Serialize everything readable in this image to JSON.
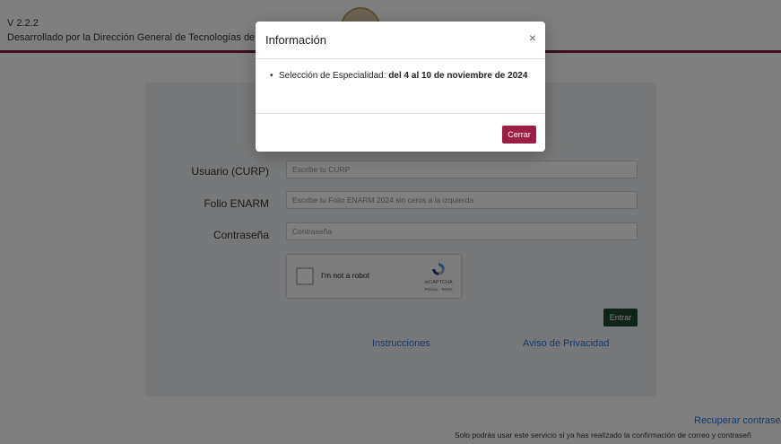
{
  "header": {
    "version": "V 2.2.2",
    "developer": "Desarrollado por la Dirección General de Tecnologías de la"
  },
  "form": {
    "curp_label": "Usuario (CURP)",
    "curp_placeholder": "Escribe tu CURP",
    "folio_label": "Folio ENARM",
    "folio_placeholder": "Escribe tu Folio ENARM 2024 sin ceros a la izquierda",
    "password_label": "Contraseña",
    "password_placeholder": "Contraseña",
    "recaptcha": {
      "label": "I'm not a robot",
      "brand": "reCAPTCHA",
      "terms": "Privacy - Terms"
    },
    "submit_label": "Entrar"
  },
  "links": {
    "instrucciones": "Instrucciones",
    "privacidad": "Aviso de Privacidad",
    "recuperar": "Recuperar contraseñ"
  },
  "footer_note": "Solo podrás usar este servicio si ya has realizado la confirmación de correo y contraseñ",
  "modal": {
    "title": "Información",
    "close_symbol": "×",
    "item_prefix": "Selección de Especialidad: ",
    "item_bold": "del 4 al 10 de noviembre de 2024",
    "close_button": "Cerrar"
  },
  "colors": {
    "accent": "#7a1d36",
    "primary_button": "#1f4b35",
    "modal_button": "#9b1f45",
    "link": "#2a6fd6"
  }
}
